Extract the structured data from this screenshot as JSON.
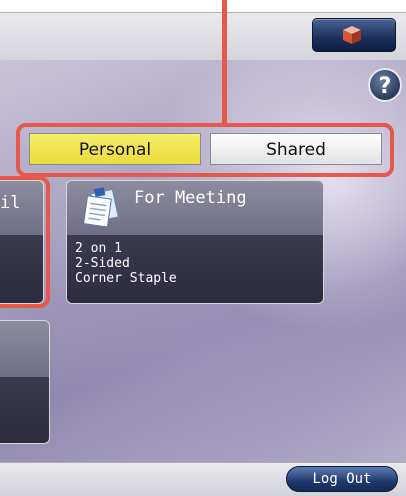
{
  "help": {
    "label": "?"
  },
  "tabs": [
    {
      "label": "Personal",
      "selected": true,
      "color": "#eee04c"
    },
    {
      "label": "Shared",
      "selected": false,
      "color": "#f2f2f4"
    }
  ],
  "favorites": [
    {
      "title_fragment": "il"
    },
    {
      "title": "For Meeting",
      "settings": [
        "2 on 1",
        "2-Sided",
        "Corner Staple"
      ]
    }
  ],
  "footer": {
    "logout_label": "Log Out"
  },
  "icons": {
    "top_button": "cube-icon",
    "favorite": "document-stack-icon"
  },
  "accent": {
    "highlight": "#e5584a",
    "nav_button": "#1b2f5a"
  }
}
